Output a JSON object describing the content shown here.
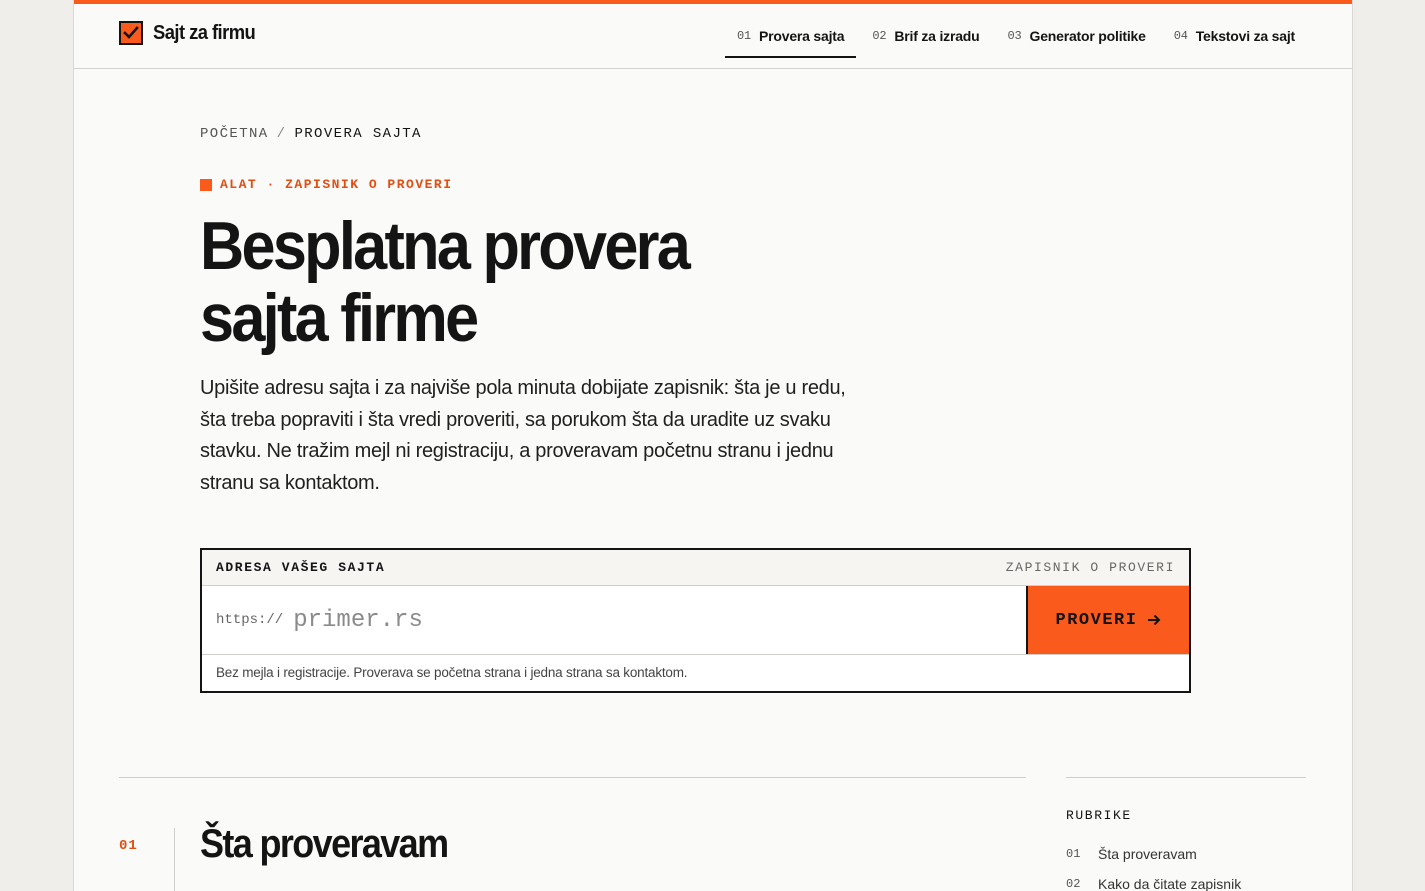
{
  "colors": {
    "accent": "#fa5a1c",
    "ink": "#141414",
    "paper": "#fafaf8"
  },
  "brand": {
    "name": "Sajt za firmu",
    "icon": "checkbox-check-icon"
  },
  "nav": [
    {
      "num": "01",
      "label": "Provera sajta",
      "active": true
    },
    {
      "num": "02",
      "label": "Brif za izradu",
      "active": false
    },
    {
      "num": "03",
      "label": "Generator politike",
      "active": false
    },
    {
      "num": "04",
      "label": "Tekstovi za sajt",
      "active": false
    }
  ],
  "breadcrumb": {
    "home": "POČETNA",
    "sep": "/",
    "current": "PROVERA SAJTA"
  },
  "eyebrow": "ALAT · ZAPISNIK O PROVERI",
  "hero": {
    "title": "Besplatna provera sajta firme",
    "lede": "Upišite adresu sajta i za najviše pola minuta dobijate zapisnik: šta je u redu, šta treba popraviti i šta vredi proveriti, sa porukom šta da uradite uz svaku stavku. Ne tražim mejl ni registraciju, a proveravam početnu stranu i jednu stranu sa kontaktom."
  },
  "checker": {
    "label": "ADRESA VAŠEG SAJTA",
    "tag": "ZAPISNIK O PROVERI",
    "prefix": "https://",
    "placeholder": "primer.rs",
    "value": "",
    "button": "PROVERI",
    "button_icon": "arrow-right-icon",
    "note": "Bez mejla i registracije. Proverava se početna strana i jedna strana sa kontaktom."
  },
  "section": {
    "num": "01",
    "title": "Šta proveravam"
  },
  "rubrike": {
    "title": "RUBRIKE",
    "items": [
      {
        "num": "01",
        "label": "Šta proveravam"
      },
      {
        "num": "02",
        "label": "Kako da čitate zapisnik"
      }
    ]
  }
}
